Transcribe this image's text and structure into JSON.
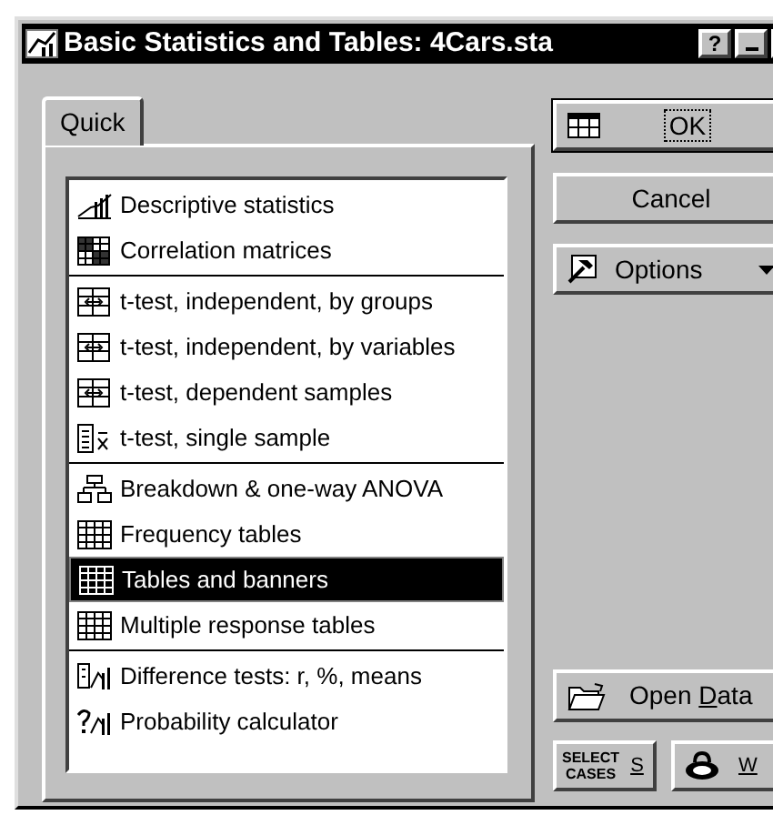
{
  "window": {
    "title": "Basic Statistics and Tables: 4Cars.sta",
    "help": "?"
  },
  "tabs": [
    {
      "label": "Quick",
      "selected": true
    }
  ],
  "list": {
    "groups": [
      {
        "items": [
          {
            "label": "Descriptive statistics",
            "selected": false
          },
          {
            "label": "Correlation matrices",
            "selected": false
          }
        ]
      },
      {
        "items": [
          {
            "label": "t-test, independent, by groups",
            "selected": false
          },
          {
            "label": "t-test, independent, by variables",
            "selected": false
          },
          {
            "label": "t-test, dependent samples",
            "selected": false
          },
          {
            "label": "t-test, single sample",
            "selected": false
          }
        ]
      },
      {
        "items": [
          {
            "label": "Breakdown & one-way ANOVA",
            "selected": false
          },
          {
            "label": "Frequency tables",
            "selected": false
          },
          {
            "label": "Tables and banners",
            "selected": true
          },
          {
            "label": "Multiple response tables",
            "selected": false
          }
        ]
      },
      {
        "items": [
          {
            "label": "Difference tests: r, %, means",
            "selected": false
          },
          {
            "label": "Probability calculator",
            "selected": false
          }
        ]
      }
    ]
  },
  "buttons": {
    "ok": "OK",
    "cancel": "Cancel",
    "options": "Options",
    "open_data": {
      "before": "Open ",
      "accel": "D",
      "after": "ata"
    },
    "select_cases": {
      "line_1": "SELECT",
      "line_2": "CASES",
      "accel": "S"
    },
    "weight": {
      "accel": "W"
    }
  }
}
